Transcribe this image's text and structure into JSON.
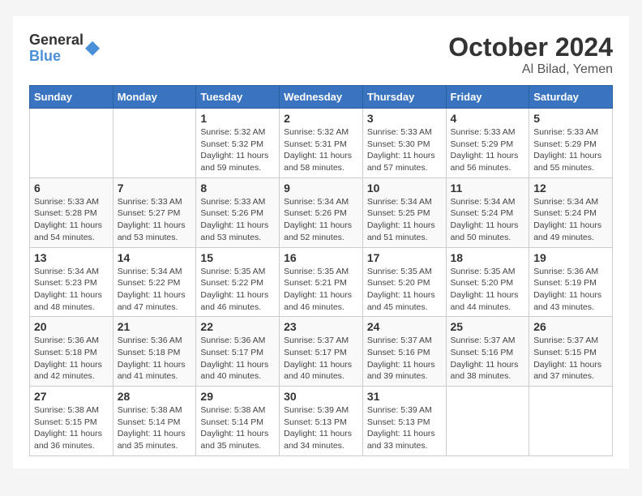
{
  "logo": {
    "line1": "General",
    "line2": "Blue"
  },
  "title": "October 2024",
  "subtitle": "Al Bilad, Yemen",
  "headers": [
    "Sunday",
    "Monday",
    "Tuesday",
    "Wednesday",
    "Thursday",
    "Friday",
    "Saturday"
  ],
  "weeks": [
    [
      {
        "day": "",
        "detail": ""
      },
      {
        "day": "",
        "detail": ""
      },
      {
        "day": "1",
        "detail": "Sunrise: 5:32 AM\nSunset: 5:32 PM\nDaylight: 11 hours and 59 minutes."
      },
      {
        "day": "2",
        "detail": "Sunrise: 5:32 AM\nSunset: 5:31 PM\nDaylight: 11 hours and 58 minutes."
      },
      {
        "day": "3",
        "detail": "Sunrise: 5:33 AM\nSunset: 5:30 PM\nDaylight: 11 hours and 57 minutes."
      },
      {
        "day": "4",
        "detail": "Sunrise: 5:33 AM\nSunset: 5:29 PM\nDaylight: 11 hours and 56 minutes."
      },
      {
        "day": "5",
        "detail": "Sunrise: 5:33 AM\nSunset: 5:29 PM\nDaylight: 11 hours and 55 minutes."
      }
    ],
    [
      {
        "day": "6",
        "detail": "Sunrise: 5:33 AM\nSunset: 5:28 PM\nDaylight: 11 hours and 54 minutes."
      },
      {
        "day": "7",
        "detail": "Sunrise: 5:33 AM\nSunset: 5:27 PM\nDaylight: 11 hours and 53 minutes."
      },
      {
        "day": "8",
        "detail": "Sunrise: 5:33 AM\nSunset: 5:26 PM\nDaylight: 11 hours and 53 minutes."
      },
      {
        "day": "9",
        "detail": "Sunrise: 5:34 AM\nSunset: 5:26 PM\nDaylight: 11 hours and 52 minutes."
      },
      {
        "day": "10",
        "detail": "Sunrise: 5:34 AM\nSunset: 5:25 PM\nDaylight: 11 hours and 51 minutes."
      },
      {
        "day": "11",
        "detail": "Sunrise: 5:34 AM\nSunset: 5:24 PM\nDaylight: 11 hours and 50 minutes."
      },
      {
        "day": "12",
        "detail": "Sunrise: 5:34 AM\nSunset: 5:24 PM\nDaylight: 11 hours and 49 minutes."
      }
    ],
    [
      {
        "day": "13",
        "detail": "Sunrise: 5:34 AM\nSunset: 5:23 PM\nDaylight: 11 hours and 48 minutes."
      },
      {
        "day": "14",
        "detail": "Sunrise: 5:34 AM\nSunset: 5:22 PM\nDaylight: 11 hours and 47 minutes."
      },
      {
        "day": "15",
        "detail": "Sunrise: 5:35 AM\nSunset: 5:22 PM\nDaylight: 11 hours and 46 minutes."
      },
      {
        "day": "16",
        "detail": "Sunrise: 5:35 AM\nSunset: 5:21 PM\nDaylight: 11 hours and 46 minutes."
      },
      {
        "day": "17",
        "detail": "Sunrise: 5:35 AM\nSunset: 5:20 PM\nDaylight: 11 hours and 45 minutes."
      },
      {
        "day": "18",
        "detail": "Sunrise: 5:35 AM\nSunset: 5:20 PM\nDaylight: 11 hours and 44 minutes."
      },
      {
        "day": "19",
        "detail": "Sunrise: 5:36 AM\nSunset: 5:19 PM\nDaylight: 11 hours and 43 minutes."
      }
    ],
    [
      {
        "day": "20",
        "detail": "Sunrise: 5:36 AM\nSunset: 5:18 PM\nDaylight: 11 hours and 42 minutes."
      },
      {
        "day": "21",
        "detail": "Sunrise: 5:36 AM\nSunset: 5:18 PM\nDaylight: 11 hours and 41 minutes."
      },
      {
        "day": "22",
        "detail": "Sunrise: 5:36 AM\nSunset: 5:17 PM\nDaylight: 11 hours and 40 minutes."
      },
      {
        "day": "23",
        "detail": "Sunrise: 5:37 AM\nSunset: 5:17 PM\nDaylight: 11 hours and 40 minutes."
      },
      {
        "day": "24",
        "detail": "Sunrise: 5:37 AM\nSunset: 5:16 PM\nDaylight: 11 hours and 39 minutes."
      },
      {
        "day": "25",
        "detail": "Sunrise: 5:37 AM\nSunset: 5:16 PM\nDaylight: 11 hours and 38 minutes."
      },
      {
        "day": "26",
        "detail": "Sunrise: 5:37 AM\nSunset: 5:15 PM\nDaylight: 11 hours and 37 minutes."
      }
    ],
    [
      {
        "day": "27",
        "detail": "Sunrise: 5:38 AM\nSunset: 5:15 PM\nDaylight: 11 hours and 36 minutes."
      },
      {
        "day": "28",
        "detail": "Sunrise: 5:38 AM\nSunset: 5:14 PM\nDaylight: 11 hours and 35 minutes."
      },
      {
        "day": "29",
        "detail": "Sunrise: 5:38 AM\nSunset: 5:14 PM\nDaylight: 11 hours and 35 minutes."
      },
      {
        "day": "30",
        "detail": "Sunrise: 5:39 AM\nSunset: 5:13 PM\nDaylight: 11 hours and 34 minutes."
      },
      {
        "day": "31",
        "detail": "Sunrise: 5:39 AM\nSunset: 5:13 PM\nDaylight: 11 hours and 33 minutes."
      },
      {
        "day": "",
        "detail": ""
      },
      {
        "day": "",
        "detail": ""
      }
    ]
  ]
}
